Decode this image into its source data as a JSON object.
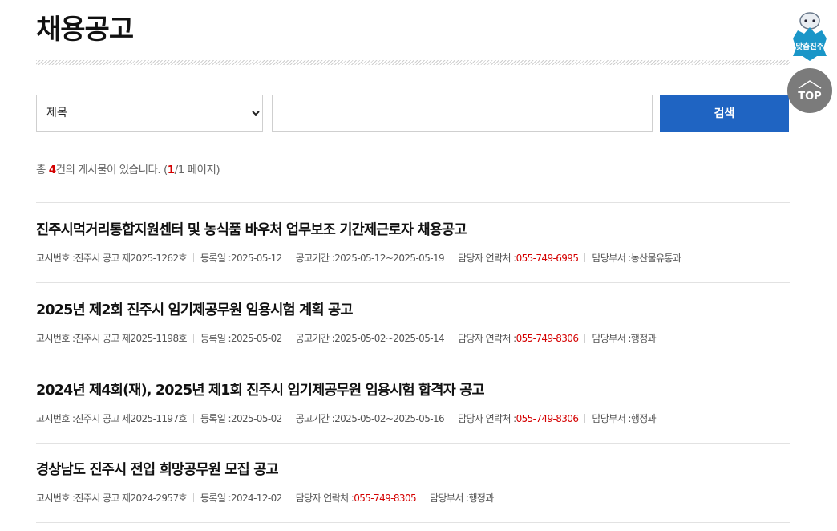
{
  "page_title": "채용공고",
  "search": {
    "field_select_value": "제목",
    "input_placeholder": "",
    "button_label": "검색"
  },
  "count": {
    "prefix": "총 ",
    "total": "4",
    "suffix": "건의 게시물이 있습니다. (",
    "current_page": "1",
    "page_tail": "/1 페이지)"
  },
  "labels": {
    "notice_no": "고시번호 : ",
    "registered": "등록일 : ",
    "period": "공고기간 : ",
    "contact": "담당자 연락처 : ",
    "department": "담당부서 : "
  },
  "posts": [
    {
      "title": "진주시먹거리통합지원센터 및 농식품 바우처 업무보조 기간제근로자 채용공고",
      "notice_no": "진주시 공고 제2025-1262호",
      "registered": "2025-05-12",
      "period": "2025-05-12~2025-05-19",
      "contact": "055-749-6995",
      "department": "농산물유통과"
    },
    {
      "title": "2025년 제2회 진주시 임기제공무원 임용시험 계획 공고",
      "notice_no": "진주시 공고 제2025-1198호",
      "registered": "2025-05-02",
      "period": "2025-05-02~2025-05-14",
      "contact": "055-749-8306",
      "department": "행정과"
    },
    {
      "title": "2024년 제4회(재), 2025년 제1회 진주시 임기제공무원 임용시험 합격자 공고",
      "notice_no": "진주시 공고 제2025-1197호",
      "registered": "2025-05-02",
      "period": "2025-05-02~2025-05-16",
      "contact": "055-749-8306",
      "department": "행정과"
    },
    {
      "title": "경상남도 진주시 전입 희망공무원 모집 공고",
      "notice_no": "진주시 공고 제2024-2957호",
      "registered": "2024-12-02",
      "contact": "055-749-8305",
      "department": "행정과"
    }
  ],
  "floating": {
    "badge_label": "맞춤진주",
    "badge_icon": "mascot-badge-icon",
    "top_label": "TOP",
    "top_icon": "chevron-up-icon"
  },
  "colors": {
    "accent_blue": "#1f64c2",
    "highlight_red": "#d40000",
    "top_button_gray": "#7b7b7b"
  }
}
